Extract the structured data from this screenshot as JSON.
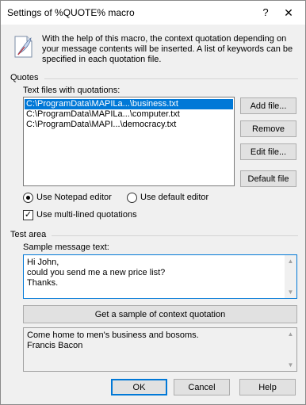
{
  "window": {
    "title": "Settings of %QUOTE% macro",
    "help_glyph": "?",
    "close_glyph": "✕"
  },
  "info": {
    "text": "With the help of this macro, the context quotation depending on your message contents will be inserted. A list of keywords can be specified in each quotation file.",
    "icon": "quill-document-icon"
  },
  "quotes": {
    "group_label": "Quotes",
    "list_label": "Text files with quotations:",
    "files": [
      "C:\\ProgramData\\MAPILa...\\business.txt",
      "C:\\ProgramData\\MAPILa...\\computer.txt",
      "C:\\ProgramData\\MAPI...\\democracy.txt"
    ],
    "selected_index": 0,
    "buttons": {
      "add": "Add file...",
      "remove": "Remove",
      "edit": "Edit file...",
      "default": "Default file"
    },
    "radio_notepad": "Use Notepad editor",
    "radio_default": "Use default editor",
    "radio_selected": "notepad",
    "checkbox_multiline": "Use multi-lined quotations",
    "checkbox_multiline_checked": true,
    "check_glyph": "✓"
  },
  "test": {
    "group_label": "Test area",
    "sample_label": "Sample message text:",
    "sample_text": "Hi John,\ncould you send me a new price list?\nThanks.",
    "sample_button": "Get a sample of context quotation",
    "result_text": "Come home to men's business and bosoms.\nFrancis Bacon",
    "scroll_up": "▲",
    "scroll_down": "▼"
  },
  "footer": {
    "ok": "OK",
    "cancel": "Cancel",
    "help": "Help"
  },
  "colors": {
    "selection": "#0078d7",
    "window_bg": "#f0f0f0"
  }
}
